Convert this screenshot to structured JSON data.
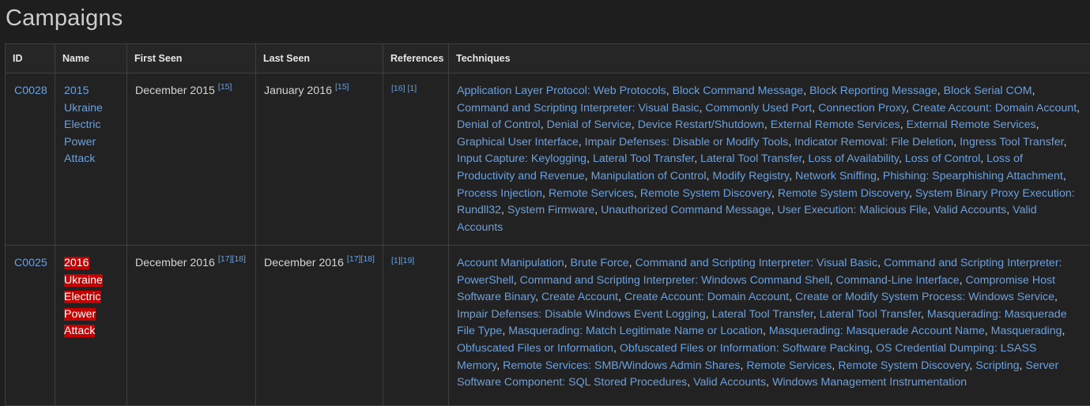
{
  "page": {
    "title": "Campaigns"
  },
  "table": {
    "headers": [
      "ID",
      "Name",
      "First Seen",
      "Last Seen",
      "References",
      "Techniques"
    ],
    "rows": [
      {
        "id": "C0028",
        "name_lines": [
          "2015",
          "Ukraine",
          "Electric",
          "Power",
          "Attack"
        ],
        "name_highlighted": false,
        "first_seen": "December 2015",
        "first_seen_refs": [
          "[15]"
        ],
        "last_seen": "January 2016",
        "last_seen_refs": [
          "[15]"
        ],
        "references": [
          "[16]",
          "[1]"
        ],
        "techniques": [
          "Application Layer Protocol: Web Protocols",
          "Block Command Message",
          "Block Reporting Message",
          "Block Serial COM",
          "Command and Scripting Interpreter: Visual Basic",
          "Commonly Used Port",
          "Connection Proxy",
          "Create Account: Domain Account",
          "Denial of Control",
          "Denial of Service",
          "Device Restart/Shutdown",
          "External Remote Services",
          "External Remote Services",
          "Graphical User Interface",
          "Impair Defenses: Disable or Modify Tools",
          "Indicator Removal: File Deletion",
          "Ingress Tool Transfer",
          "Input Capture: Keylogging",
          "Lateral Tool Transfer",
          "Lateral Tool Transfer",
          "Loss of Availability",
          "Loss of Control",
          "Loss of Productivity and Revenue",
          "Manipulation of Control",
          "Modify Registry",
          "Network Sniffing",
          "Phishing: Spearphishing Attachment",
          "Process Injection",
          "Remote Services",
          "Remote System Discovery",
          "Remote System Discovery",
          "System Binary Proxy Execution: Rundll32",
          "System Firmware",
          "Unauthorized Command Message",
          "User Execution: Malicious File",
          "Valid Accounts",
          "Valid Accounts"
        ]
      },
      {
        "id": "C0025",
        "name_lines": [
          "2016",
          "Ukraine",
          "Electric",
          "Power",
          "Attack"
        ],
        "name_highlighted": true,
        "first_seen": "December 2016",
        "first_seen_refs": [
          "[17]",
          "[18]"
        ],
        "last_seen": "December 2016",
        "last_seen_refs": [
          "[17]",
          "[18]"
        ],
        "references": [
          "[1]",
          "[19]"
        ],
        "techniques": [
          "Account Manipulation",
          "Brute Force",
          "Command and Scripting Interpreter: Visual Basic",
          "Command and Scripting Interpreter: PowerShell",
          "Command and Scripting Interpreter: Windows Command Shell",
          "Command-Line Interface",
          "Compromise Host Software Binary",
          "Create Account",
          "Create Account: Domain Account",
          "Create or Modify System Process: Windows Service",
          "Impair Defenses: Disable Windows Event Logging",
          "Lateral Tool Transfer",
          "Lateral Tool Transfer",
          "Masquerading: Masquerade File Type",
          "Masquerading: Match Legitimate Name or Location",
          "Masquerading: Masquerade Account Name",
          "Masquerading",
          "Obfuscated Files or Information",
          "Obfuscated Files or Information: Software Packing",
          "OS Credential Dumping: LSASS Memory",
          "Remote Services: SMB/Windows Admin Shares",
          "Remote Services",
          "Remote System Discovery",
          "Scripting",
          "Server Software Component: SQL Stored Procedures",
          "Valid Accounts",
          "Windows Management Instrumentation"
        ]
      }
    ]
  },
  "colors": {
    "background": "#1e1e1e",
    "link": "#6ca0dc",
    "highlight": "#c40000",
    "border": "#3f3f3f"
  }
}
